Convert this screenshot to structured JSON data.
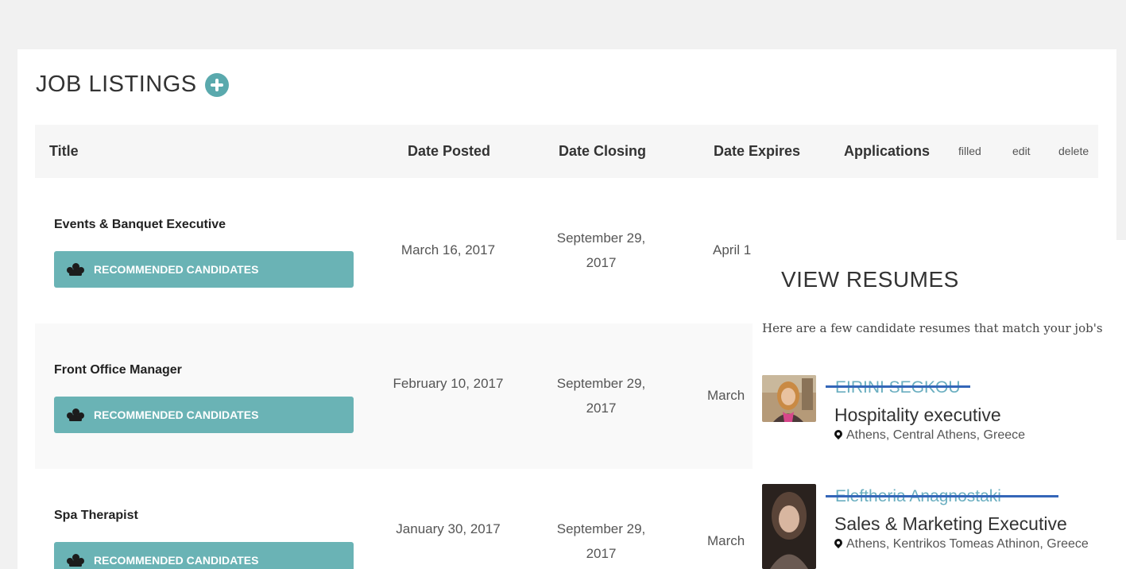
{
  "header": {
    "title": "JOB LISTINGS",
    "add_icon": "plus-circle-icon"
  },
  "table": {
    "columns": {
      "title": "Title",
      "date_posted": "Date Posted",
      "date_closing": "Date Closing",
      "date_expires": "Date Expires",
      "applications": "Applications",
      "filled": "filled",
      "edit": "edit",
      "delete": "delete"
    },
    "rows": [
      {
        "title": "Events & Banquet Executive",
        "button": "RECOMMENDED CANDIDATES",
        "posted": "March 16, 2017",
        "closing": "September 29, 2017",
        "expires": "April 1"
      },
      {
        "title": "Front Office Manager",
        "button": "RECOMMENDED CANDIDATES",
        "posted": "February 10, 2017",
        "closing": "September 29, 2017",
        "expires": "March"
      },
      {
        "title": "Spa Therapist",
        "button": "RECOMMENDED CANDIDATES",
        "posted": "January 30, 2017",
        "closing": "September 29, 2017",
        "expires": "March"
      }
    ]
  },
  "resumes": {
    "title": "VIEW RESUMES",
    "subtitle": "Here are a few candidate resumes that match your job's",
    "candidates": [
      {
        "name": "EIRINI SEGKOU",
        "role": "Hospitality executive",
        "location": "Athens, Central Athens, Greece"
      },
      {
        "name": "Eleftheria Anagnostaki",
        "role": "Sales & Marketing Executive",
        "location": "Athens, Kentrikos Tomeas Athinon, Greece"
      }
    ]
  },
  "colors": {
    "accent": "#5aa9ad",
    "button": "#6ab3b5",
    "strike": "#3466b8",
    "link": "#6aaec0"
  }
}
